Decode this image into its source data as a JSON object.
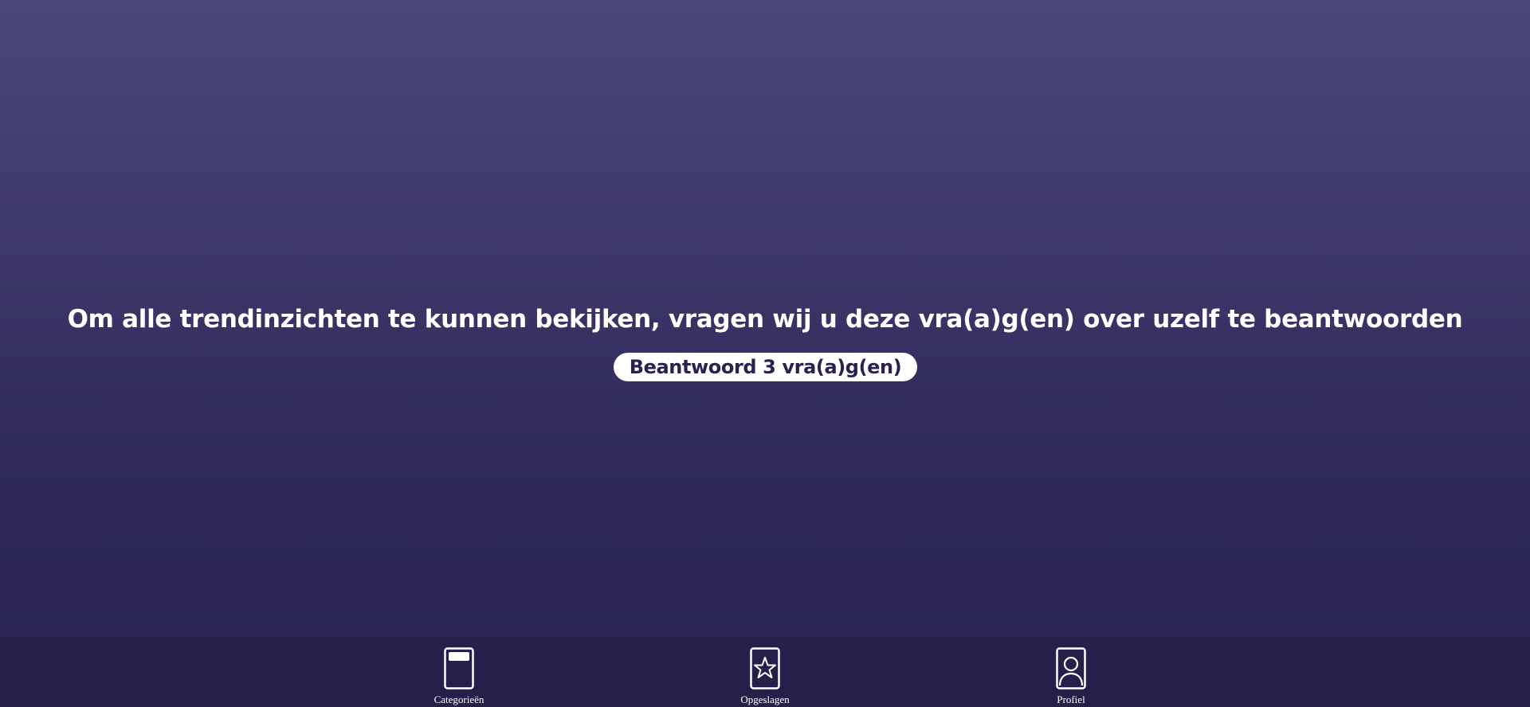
{
  "main": {
    "prompt_title": "Om alle trendinzichten te kunnen bekijken, vragen wij u deze vra(a)g(en) over uzelf te beantwoorden",
    "answer_button_label": "Beantwoord 3 vra(a)g(en)"
  },
  "bottom_nav": {
    "items": [
      {
        "label": "Categorieën",
        "icon": "category-card-icon"
      },
      {
        "label": "Opgeslagen",
        "icon": "star-card-icon"
      },
      {
        "label": "Profiel",
        "icon": "profile-card-icon"
      }
    ]
  },
  "colors": {
    "background_top": "#4b4779",
    "background_bottom": "#28234f",
    "nav_background": "#25204a",
    "button_background": "#ffffff",
    "button_text": "#27224e"
  }
}
